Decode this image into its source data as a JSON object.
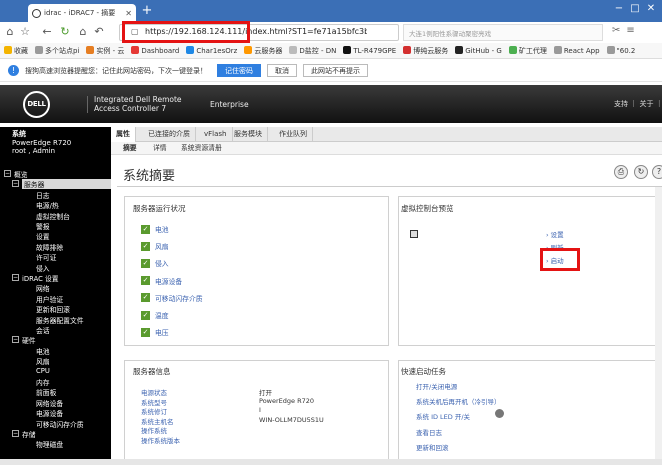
{
  "browser": {
    "tab_title": "idrac - iDRAC7 - 摘要",
    "tab_close": "✕",
    "new_tab": "+",
    "window_buttons": [
      "−",
      "□",
      "✕"
    ],
    "url": "https://192.168.124.111/index.html?ST1=fe71a15bfc3bc900ae6fb1d0",
    "search_placeholder": "大连1例阳性系骤动聚密亮戏",
    "bookmarks": [
      "收藏",
      "多个站点pi",
      "实例 - 云",
      "Dashboard",
      "Char1esOrz",
      "云服务器",
      "D盐控 - DN",
      "TL-R479GPE",
      "博纯云服务",
      "GitHub - G",
      "矿工代理",
      "React App",
      "\"60.2"
    ]
  },
  "password_bar": {
    "message": "搜狗高速浏览器提醒您：记住此网站密码，下次一键登录！",
    "save_label": "记住密码",
    "cancel_label": "取消",
    "never_label": "此网站不再提示"
  },
  "header": {
    "logo_text": "DELL",
    "product_title": "Integrated Dell Remote Access Controller 7",
    "edition": "Enterprise",
    "links": "支持 ｜ 关于 ｜ 退"
  },
  "system": {
    "label": "系统",
    "model": "PowerEdge R720",
    "user": "root , Admin"
  },
  "tree": [
    {
      "label": "概览",
      "indent": 1,
      "exp": "−"
    },
    {
      "label": "服务器",
      "indent": 2,
      "exp": "−",
      "selected": true
    },
    {
      "label": "日志",
      "indent": 3
    },
    {
      "label": "电源/热",
      "indent": 3
    },
    {
      "label": "虚拟控制台",
      "indent": 3
    },
    {
      "label": "警报",
      "indent": 3
    },
    {
      "label": "设置",
      "indent": 3
    },
    {
      "label": "故障排除",
      "indent": 3
    },
    {
      "label": "许可证",
      "indent": 3
    },
    {
      "label": "侵入",
      "indent": 3
    },
    {
      "label": "iDRAC 设置",
      "indent": 2,
      "exp": "−"
    },
    {
      "label": "网络",
      "indent": 3
    },
    {
      "label": "用户验证",
      "indent": 3
    },
    {
      "label": "更新和回滚",
      "indent": 3
    },
    {
      "label": "服务器配置文件",
      "indent": 3
    },
    {
      "label": "会话",
      "indent": 3
    },
    {
      "label": "硬件",
      "indent": 2,
      "exp": "−"
    },
    {
      "label": "电池",
      "indent": 3
    },
    {
      "label": "风扇",
      "indent": 3
    },
    {
      "label": "CPU",
      "indent": 3
    },
    {
      "label": "内存",
      "indent": 3
    },
    {
      "label": "前面板",
      "indent": 3
    },
    {
      "label": "网络设备",
      "indent": 3
    },
    {
      "label": "电源设备",
      "indent": 3
    },
    {
      "label": "可移动闪存介质",
      "indent": 3
    },
    {
      "label": "存储",
      "indent": 2,
      "exp": "−"
    },
    {
      "label": "物理磁盘",
      "indent": 3
    }
  ],
  "tabs": [
    "属性",
    "已连接的介质",
    "vFlash",
    "服务模块",
    "作业队列"
  ],
  "subtabs": [
    "摘要",
    "详情",
    "系统资源清册"
  ],
  "page_title": "系统摘要",
  "toolbar_icons": [
    "print-icon",
    "refresh-icon"
  ],
  "health": {
    "title": "服务器运行状况",
    "items": [
      "电池",
      "风扇",
      "侵入",
      "电源设备",
      "可移动闪存介质",
      "温度",
      "电压"
    ]
  },
  "vconsole": {
    "title": "虚拟控制台预览",
    "links": [
      "设置",
      "刷新",
      "启动"
    ]
  },
  "server_info": {
    "title": "服务器信息",
    "rows": [
      {
        "label": "电源状态",
        "value": "打开"
      },
      {
        "label": "系统型号",
        "value": "PowerEdge R720"
      },
      {
        "label": "系统修订",
        "value": "I"
      },
      {
        "label": "系统主机名",
        "value": "WIN-OLLM7DU5S1U"
      },
      {
        "label": "操作系统",
        "value": ""
      },
      {
        "label": "操作系统版本",
        "value": ""
      }
    ]
  },
  "quick_launch": {
    "title": "快速启动任务",
    "links": [
      "打开/关闭电源",
      "系统关机后再开机（冷引导）",
      "系统 ID LED 开/关",
      "查看日志",
      "更新和回滚",
      "重设 iDRAC"
    ]
  },
  "status_text": "javascript:void(0)"
}
